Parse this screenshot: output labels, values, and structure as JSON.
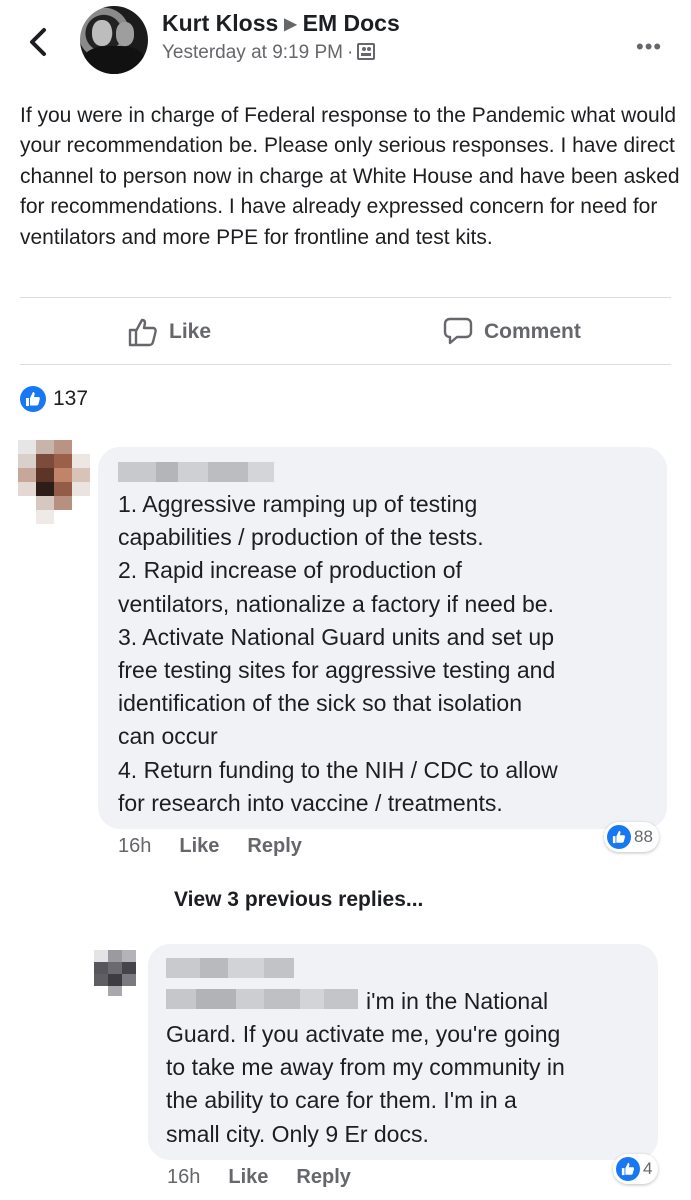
{
  "header": {
    "author": "Kurt Kloss",
    "group": "EM Docs",
    "timestamp": "Yesterday at 9:19 PM",
    "separator": "·"
  },
  "post": {
    "text": "If you were in charge of Federal response to the Pandemic what would your recommendation be. Please only serious responses. I have direct channel to person now in charge at White House and have been asked for recommendations. I have already expressed concern for need for ventilators and more PPE for frontline and test kits.",
    "actions": {
      "like": "Like",
      "comment": "Comment"
    },
    "reaction_count": "137"
  },
  "comments": [
    {
      "lines": [
        "1. Aggressive ramping up of testing",
        "capabilities / production of the tests.",
        "2. Rapid increase of production of",
        "ventilators, nationalize a factory if need be.",
        "3. Activate National Guard units and set up",
        "free testing sites for aggressive testing  and",
        "identification of the sick so that isolation",
        "can occur",
        "4. Return funding to the NIH / CDC to allow",
        "for research into vaccine / treatments."
      ],
      "time": "16h",
      "like": "Like",
      "reply": "Reply",
      "reactions": "88"
    }
  ],
  "view_previous": "View 3 previous replies...",
  "replies": [
    {
      "first_line": "i'm in the National",
      "lines": [
        "Guard. If you activate me, you're going",
        "to take me away from my community in",
        "the ability to care for them. I'm in a",
        "small city. Only 9 Er docs."
      ],
      "time": "16h",
      "like": "Like",
      "reply": "Reply",
      "reactions": "4"
    }
  ],
  "colors": {
    "accent": "#1877f2",
    "bubble": "#f0f2f5",
    "secondary_text": "#65676b"
  },
  "icons": [
    "back-chevron-icon",
    "group-icon",
    "more-icon",
    "thumbs-up-icon",
    "comment-icon"
  ]
}
